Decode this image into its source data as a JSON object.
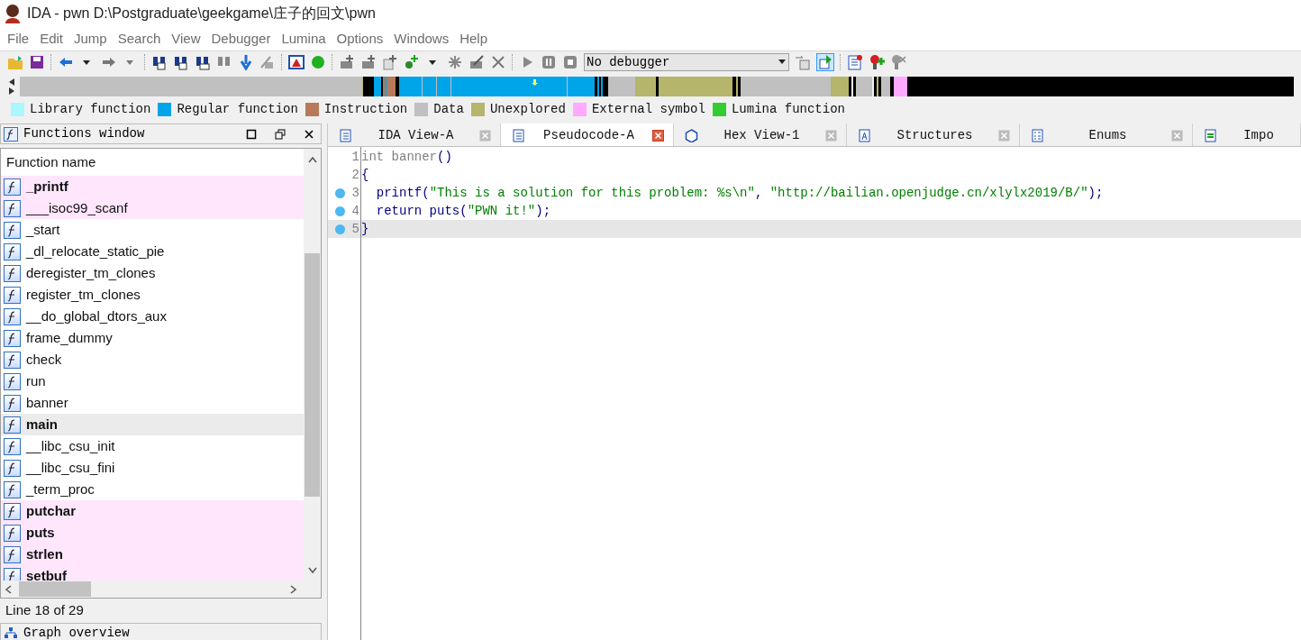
{
  "window": {
    "title": "IDA - pwn D:\\Postgraduate\\geekgame\\庄子的回文\\pwn"
  },
  "menu": [
    "File",
    "Edit",
    "Jump",
    "Search",
    "View",
    "Debugger",
    "Lumina",
    "Options",
    "Windows",
    "Help"
  ],
  "toolbar": {
    "debugger_select": "No debugger"
  },
  "legend": [
    {
      "label": "Library function",
      "color": "#aaf7ff"
    },
    {
      "label": "Regular function",
      "color": "#00a4e8"
    },
    {
      "label": "Instruction",
      "color": "#b87a5a"
    },
    {
      "label": "Data",
      "color": "#c0c0c0"
    },
    {
      "label": "Unexplored",
      "color": "#b5b56b"
    },
    {
      "label": "External symbol",
      "color": "#ffa9ff"
    },
    {
      "label": "Lumina function",
      "color": "#33cc33"
    }
  ],
  "functions_window": {
    "title": "Functions window",
    "column": "Function name",
    "rows": [
      {
        "name": "_printf",
        "imported": true,
        "bold": true,
        "selected": false
      },
      {
        "name": "___isoc99_scanf",
        "imported": true,
        "bold": false,
        "selected": false
      },
      {
        "name": "_start",
        "imported": false,
        "bold": false,
        "selected": false
      },
      {
        "name": "_dl_relocate_static_pie",
        "imported": false,
        "bold": false,
        "selected": false
      },
      {
        "name": "deregister_tm_clones",
        "imported": false,
        "bold": false,
        "selected": false
      },
      {
        "name": "register_tm_clones",
        "imported": false,
        "bold": false,
        "selected": false
      },
      {
        "name": "__do_global_dtors_aux",
        "imported": false,
        "bold": false,
        "selected": false
      },
      {
        "name": "frame_dummy",
        "imported": false,
        "bold": false,
        "selected": false
      },
      {
        "name": "check",
        "imported": false,
        "bold": false,
        "selected": false
      },
      {
        "name": "run",
        "imported": false,
        "bold": false,
        "selected": false
      },
      {
        "name": "banner",
        "imported": false,
        "bold": false,
        "selected": false
      },
      {
        "name": "main",
        "imported": false,
        "bold": true,
        "selected": true
      },
      {
        "name": "__libc_csu_init",
        "imported": false,
        "bold": false,
        "selected": false
      },
      {
        "name": "__libc_csu_fini",
        "imported": false,
        "bold": false,
        "selected": false
      },
      {
        "name": "_term_proc",
        "imported": false,
        "bold": false,
        "selected": false
      },
      {
        "name": "putchar",
        "imported": true,
        "bold": true,
        "selected": false
      },
      {
        "name": "puts",
        "imported": true,
        "bold": true,
        "selected": false
      },
      {
        "name": "strlen",
        "imported": true,
        "bold": true,
        "selected": false
      },
      {
        "name": "setbuf",
        "imported": true,
        "bold": true,
        "selected": false
      }
    ],
    "status": "Line 18 of 29"
  },
  "graph_overview": {
    "title": "Graph overview"
  },
  "tabs": [
    {
      "label": "IDA View-A",
      "selected": false
    },
    {
      "label": "Pseudocode-A",
      "selected": true
    },
    {
      "label": "Hex View-1",
      "selected": false
    },
    {
      "label": "Structures",
      "selected": false
    },
    {
      "label": "Enums",
      "selected": false
    },
    {
      "label": "Impo",
      "selected": false
    }
  ],
  "code": [
    {
      "number": "1",
      "breakpoint": false,
      "current": false,
      "tokens": [
        {
          "kind": "plain",
          "text": "int banner"
        },
        {
          "kind": "punct",
          "text": "()"
        }
      ]
    },
    {
      "number": "2",
      "breakpoint": false,
      "current": false,
      "tokens": [
        {
          "kind": "punct",
          "text": "{"
        }
      ]
    },
    {
      "number": "3",
      "breakpoint": true,
      "current": false,
      "tokens": [
        {
          "kind": "call",
          "text": "  printf"
        },
        {
          "kind": "punct",
          "text": "("
        },
        {
          "kind": "string",
          "text": "\"This is a solution for this problem: %s\\n\""
        },
        {
          "kind": "punct",
          "text": ", "
        },
        {
          "kind": "string",
          "text": "\"http://bailian.openjudge.cn/xlylx2019/B/\""
        },
        {
          "kind": "punct",
          "text": ");"
        }
      ]
    },
    {
      "number": "4",
      "breakpoint": true,
      "current": false,
      "tokens": [
        {
          "kind": "call",
          "text": "  return puts"
        },
        {
          "kind": "punct",
          "text": "("
        },
        {
          "kind": "string",
          "text": "\"PWN it!\""
        },
        {
          "kind": "punct",
          "text": ");"
        }
      ]
    },
    {
      "number": "5",
      "breakpoint": true,
      "current": true,
      "tokens": [
        {
          "kind": "punct",
          "text": "}"
        }
      ]
    }
  ]
}
